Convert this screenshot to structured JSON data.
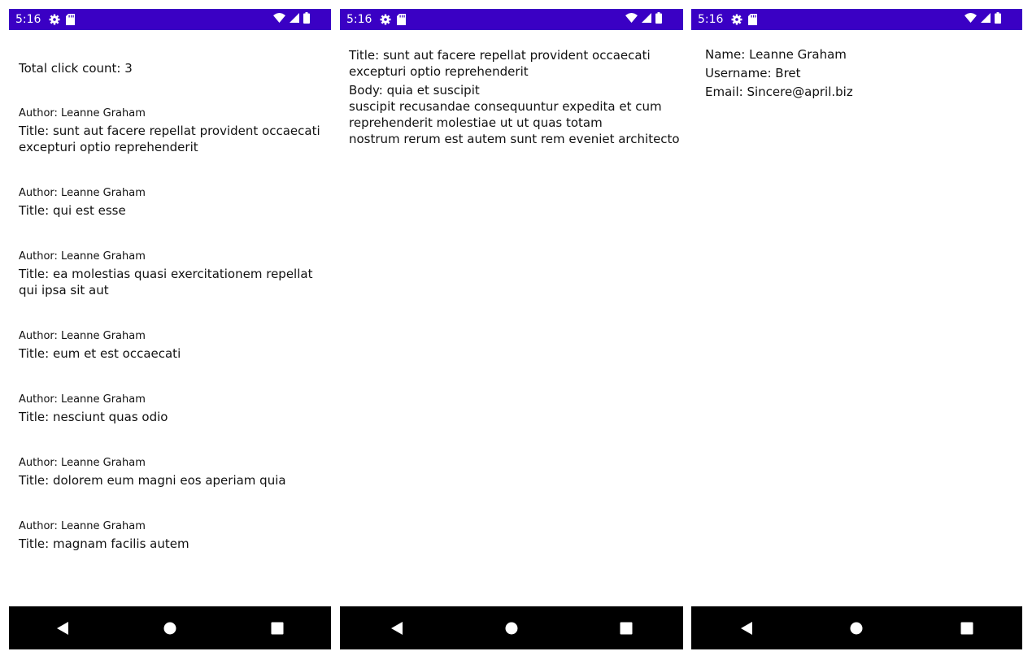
{
  "status_bar": {
    "time": "5:16",
    "color": "#3a00c4"
  },
  "icons": {
    "settings": "gear-icon",
    "sd_card": "sd-card-icon",
    "wifi": "wifi-icon",
    "signal": "cell-signal-icon",
    "battery": "battery-icon",
    "back": "back-icon",
    "home": "home-icon",
    "recents": "recents-icon"
  },
  "posts_screen": {
    "click_count": "Total click count: 3",
    "posts": [
      {
        "author": "Author: Leanne Graham",
        "title": "Title: sunt aut facere repellat provident occaecati excepturi optio reprehenderit"
      },
      {
        "author": "Author: Leanne Graham",
        "title": "Title: qui est esse"
      },
      {
        "author": "Author: Leanne Graham",
        "title": "Title: ea molestias quasi exercitationem repellat qui ipsa sit aut"
      },
      {
        "author": "Author: Leanne Graham",
        "title": "Title: eum et est occaecati"
      },
      {
        "author": "Author: Leanne Graham",
        "title": "Title: nesciunt quas odio"
      },
      {
        "author": "Author: Leanne Graham",
        "title": "Title: dolorem eum magni eos aperiam quia"
      },
      {
        "author": "Author: Leanne Graham",
        "title": "Title: magnam facilis autem"
      }
    ]
  },
  "post_detail_screen": {
    "title": "Title: sunt aut facere repellat provident occaecati excepturi optio reprehenderit",
    "body_label": "Body: quia et suscipit",
    "body": "suscipit recusandae consequuntur expedita et cum\nreprehenderit molestiae ut ut quas totam\nnostrum rerum est autem sunt rem eveniet architecto"
  },
  "user_screen": {
    "name": "Name: Leanne Graham",
    "username": "Username: Bret",
    "email": "Email: Sincere@april.biz"
  }
}
